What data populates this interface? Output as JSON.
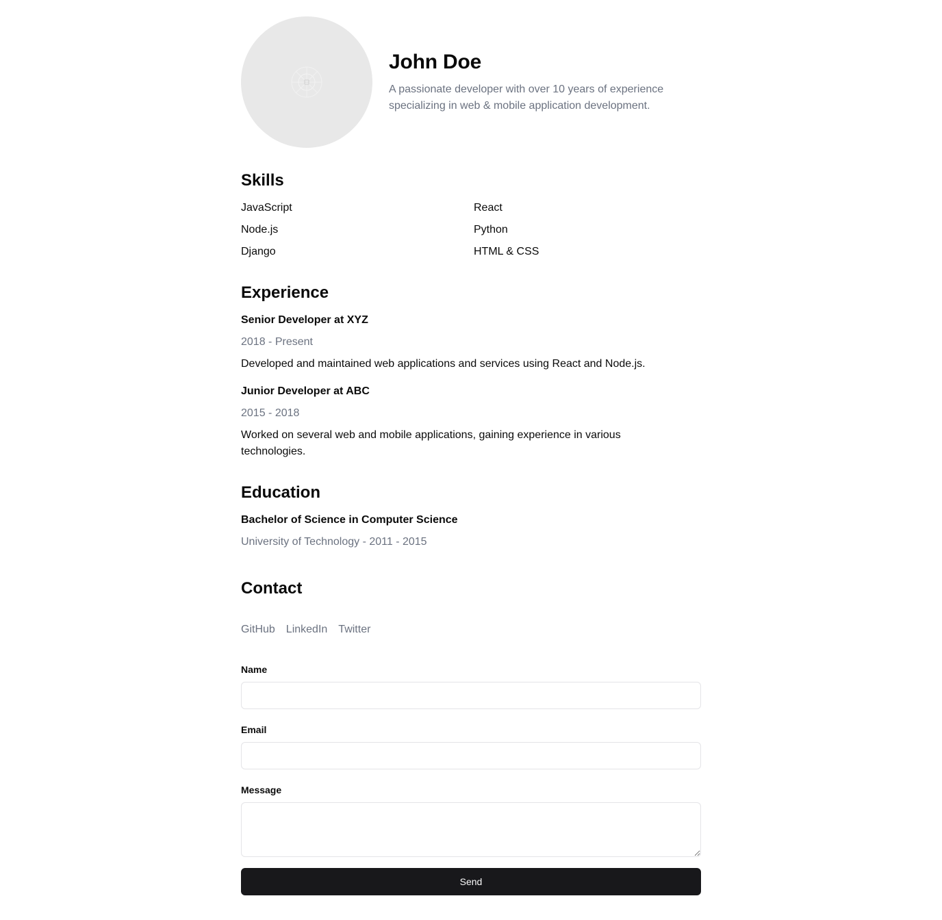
{
  "profile": {
    "name": "John Doe",
    "bio": "A passionate developer with over 10 years of experience specializing in web & mobile application development.",
    "avatar_icon": "image-placeholder-icon"
  },
  "skills": {
    "title": "Skills",
    "items": [
      "JavaScript",
      "React",
      "Node.js",
      "Python",
      "Django",
      "HTML & CSS"
    ]
  },
  "experience": {
    "title": "Experience",
    "jobs": [
      {
        "title": "Senior Developer at XYZ",
        "dates": "2018 - Present",
        "description": "Developed and maintained web applications and services using React and Node.js."
      },
      {
        "title": "Junior Developer at ABC",
        "dates": "2015 - 2018",
        "description": "Worked on several web and mobile applications, gaining experience in various technologies."
      }
    ]
  },
  "education": {
    "title": "Education",
    "items": [
      {
        "degree": "Bachelor of Science in Computer Science",
        "info": "University of Technology - 2011 - 2015"
      }
    ]
  },
  "contact": {
    "title": "Contact",
    "links": [
      "GitHub",
      "LinkedIn",
      "Twitter"
    ],
    "form": {
      "name_label": "Name",
      "name_value": "",
      "email_label": "Email",
      "email_value": "",
      "message_label": "Message",
      "message_value": "",
      "submit_label": "Send"
    }
  },
  "colors": {
    "text": "#0a0a0a",
    "muted": "#6b7280",
    "button_bg": "#18181b",
    "avatar_bg": "#e8e8e8",
    "border": "#e4e4e7"
  }
}
